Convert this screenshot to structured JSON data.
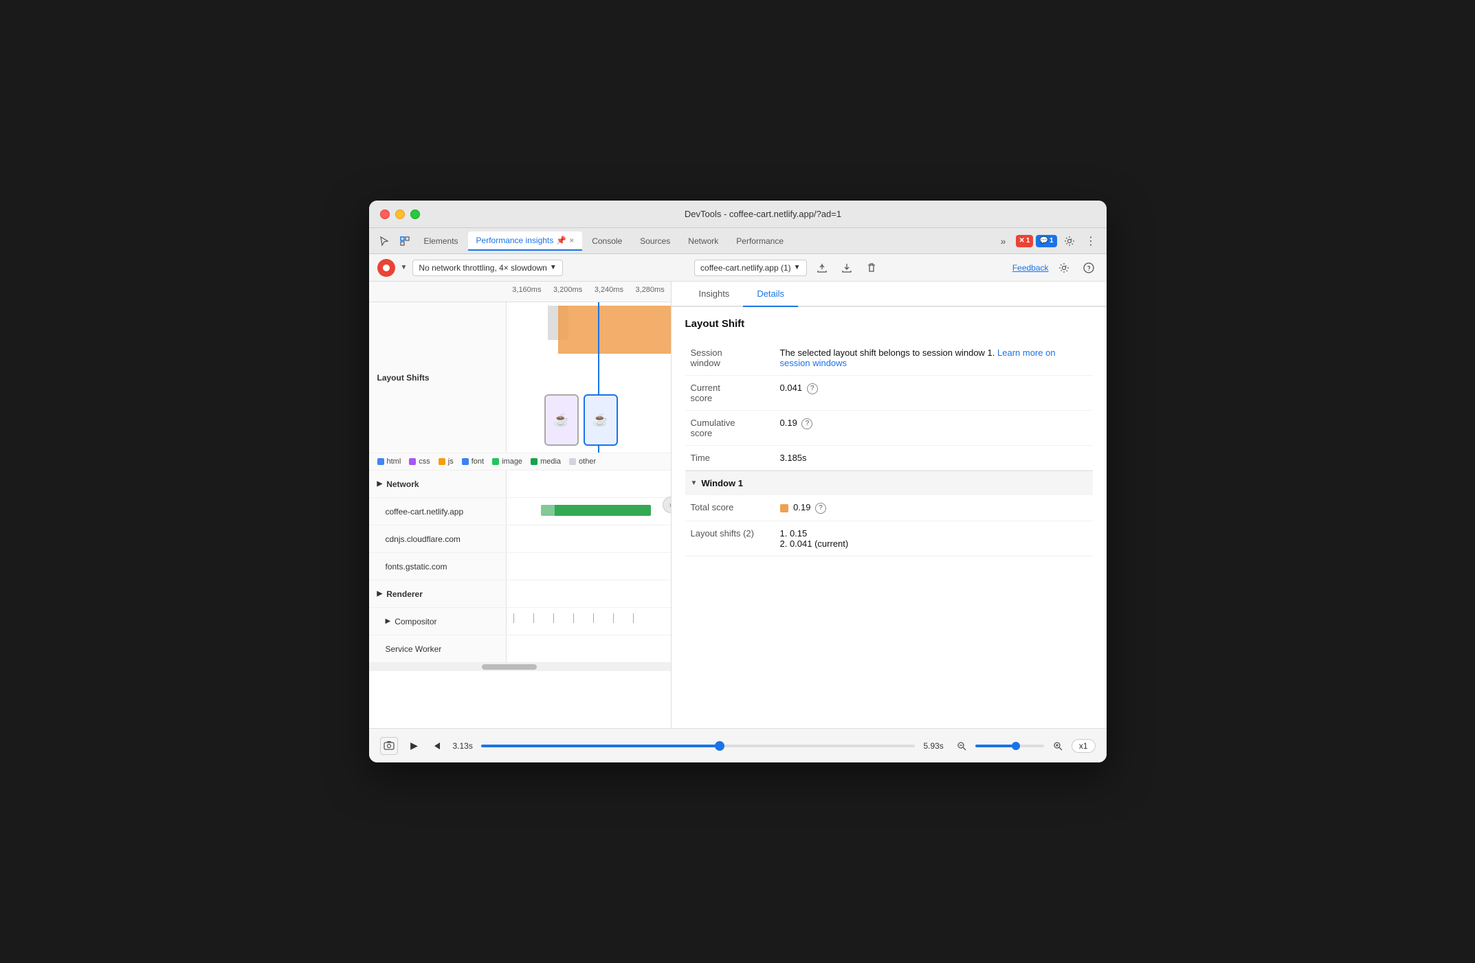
{
  "window": {
    "title": "DevTools - coffee-cart.netlify.app/?ad=1"
  },
  "tabs": {
    "items": [
      {
        "label": "Elements",
        "active": false
      },
      {
        "label": "Performance insights",
        "active": true,
        "pinned": true
      },
      {
        "label": "Console",
        "active": false
      },
      {
        "label": "Sources",
        "active": false
      },
      {
        "label": "Network",
        "active": false
      },
      {
        "label": "Performance",
        "active": false
      }
    ],
    "more_label": "»",
    "error_count": "1",
    "comment_count": "1"
  },
  "toolbar": {
    "record_title": "Record",
    "throttle_label": "No network throttling, 4× slowdown",
    "target_label": "coffee-cart.netlify.app (1)",
    "feedback_label": "Feedback",
    "export_title": "Export",
    "import_title": "Import",
    "delete_title": "Delete"
  },
  "timeline": {
    "time_markers": [
      "3,160ms",
      "3,200ms",
      "3,240ms",
      "3,280ms"
    ],
    "sections": {
      "layout_shifts_label": "Layout Shifts",
      "network_label": "Network",
      "network_items": [
        "coffee-cart.netlify.app",
        "cdnjs.cloudflare.com",
        "fonts.gstatic.com"
      ],
      "renderer_label": "Renderer",
      "compositor_label": "Compositor",
      "service_worker_label": "Service Worker"
    }
  },
  "legend": {
    "items": [
      {
        "label": "html",
        "color": "#4285f4"
      },
      {
        "label": "css",
        "color": "#a855f7"
      },
      {
        "label": "js",
        "color": "#f59e0b"
      },
      {
        "label": "font",
        "color": "#3b82f6"
      },
      {
        "label": "image",
        "color": "#22c55e"
      },
      {
        "label": "media",
        "color": "#16a34a"
      },
      {
        "label": "other",
        "color": "#d1d5db"
      }
    ]
  },
  "right_panel": {
    "tabs": [
      {
        "label": "Insights",
        "active": false
      },
      {
        "label": "Details",
        "active": true
      }
    ],
    "details": {
      "section_title": "Layout Shift",
      "rows": [
        {
          "key": "Session window",
          "value_text": "The selected layout shift belongs to session window 1.",
          "link_text": "Learn more on",
          "link_text2": "session windows"
        },
        {
          "key": "Current score",
          "value": "0.041",
          "has_help": true
        },
        {
          "key": "Cumulative score",
          "value": "0.19",
          "has_help": true
        },
        {
          "key": "Time",
          "value": "3.185s"
        }
      ]
    },
    "window1": {
      "label": "Window 1",
      "total_score_label": "Total score",
      "total_score_value": "0.19",
      "layout_shifts_label": "Layout shifts (2)",
      "shift1": "1. 0.15",
      "shift2": "2. 0.041 (current)"
    }
  },
  "bottom_bar": {
    "time_start": "3.13s",
    "time_end": "5.93s",
    "zoom_label": "x1",
    "screenshot_tooltip": "Screenshot"
  }
}
